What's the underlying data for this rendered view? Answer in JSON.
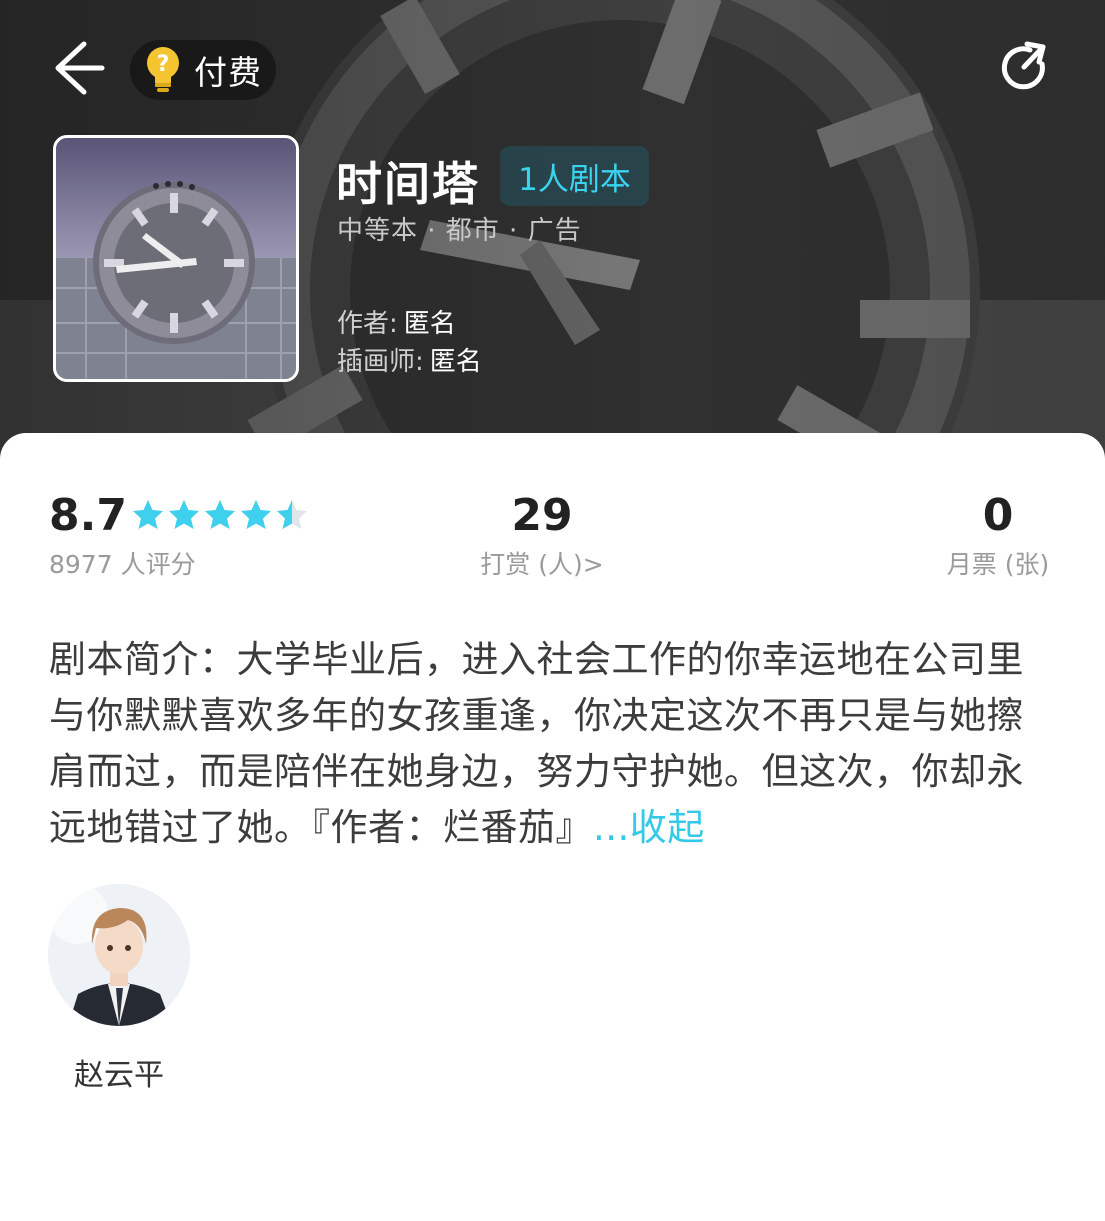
{
  "header": {
    "paid_label": "付费",
    "title": "时间塔",
    "tag": "1人剧本",
    "genres": "中等本 · 都市 · 广告",
    "author_label": "作者:",
    "author_value": "匿名",
    "illustrator_label": "插画师:",
    "illustrator_value": "匿名",
    "icons": {
      "back": "arrow-left-icon",
      "paid": "lightbulb-icon",
      "share": "share-icon"
    }
  },
  "stats": {
    "score": "8.7",
    "star_rating": 4.5,
    "raters": "8977 人评分",
    "tips_count": "29",
    "tips_label": "打赏 (人)>",
    "monthly_count": "0",
    "monthly_label": "月票 (张)"
  },
  "synopsis": {
    "text": "剧本简介：大学毕业后，进入社会工作的你幸运地在公司里与你默默喜欢多年的女孩重逢，你决定这次不再只是与她擦肩而过，而是陪伴在她身边，努力守护她。但这次，你却永远地错过了她。『作者：烂番茄』",
    "collapse_label": "...收起"
  },
  "characters": [
    {
      "name": "赵云平"
    }
  ],
  "colors": {
    "accent": "#34c9e6",
    "tag_text": "#3ad3f0",
    "star": "#3fd0ee",
    "bulb": "#f5c431"
  }
}
